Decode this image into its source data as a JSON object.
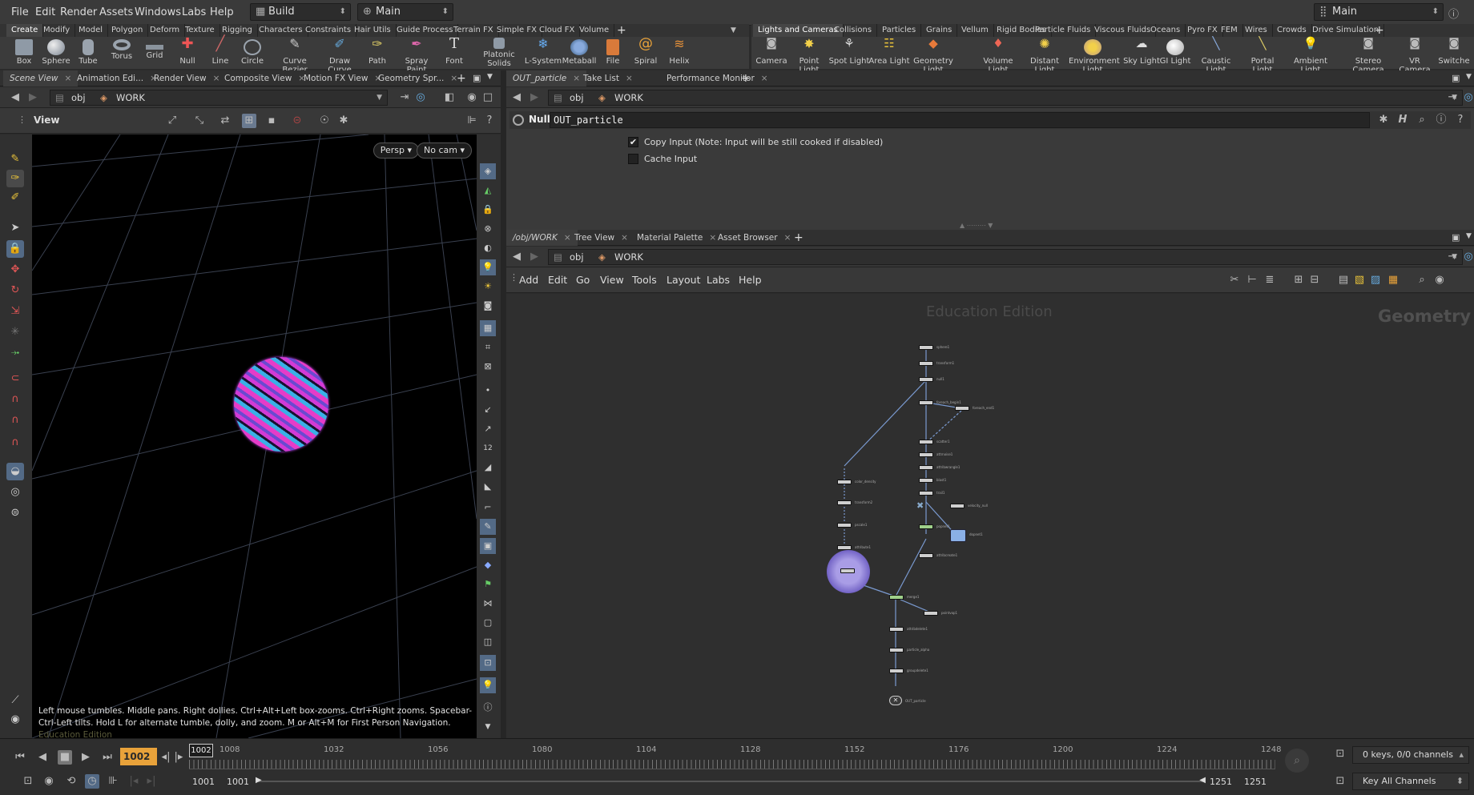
{
  "menubar": {
    "items": [
      "File",
      "Edit",
      "Render",
      "Assets",
      "Windows",
      "Labs",
      "Help"
    ],
    "desktop": "Build",
    "network": "Main",
    "right_desktop": "Main"
  },
  "shelf_left": {
    "tabs": [
      "Create",
      "Modify",
      "Model",
      "Polygon",
      "Deform",
      "Texture",
      "Rigging",
      "Characters",
      "Constraints",
      "Hair Utils",
      "Guide Process",
      "Terrain FX",
      "Simple FX",
      "Cloud FX",
      "Volume"
    ],
    "tools": [
      "Box",
      "Sphere",
      "Tube",
      "Torus",
      "Grid",
      "Null",
      "Line",
      "Circle",
      "Curve Bezier",
      "Draw Curve",
      "Path",
      "Spray Paint",
      "Font",
      "Platonic Solids",
      "L-System",
      "Metaball",
      "File",
      "Spiral",
      "Helix"
    ]
  },
  "shelf_right": {
    "tabs": [
      "Lights and Cameras",
      "Collisions",
      "Particles",
      "Grains",
      "Vellum",
      "Rigid Bodies",
      "Particle Fluids",
      "Viscous Fluids",
      "Oceans",
      "Pyro FX",
      "FEM",
      "Wires",
      "Crowds",
      "Drive Simulation"
    ],
    "tools": [
      "Camera",
      "Point Light",
      "Spot Light",
      "Area Light",
      "Geometry Light",
      "Volume Light",
      "Distant Light",
      "Environment Light",
      "Sky Light",
      "GI Light",
      "Caustic Light",
      "Portal Light",
      "Ambient Light",
      "Stereo Camera",
      "VR Camera",
      "Switche"
    ]
  },
  "left_pane": {
    "tabs": [
      "Scene View",
      "Animation Edi...",
      "Render View",
      "Composite View",
      "Motion FX View",
      "Geometry Spr..."
    ],
    "path_root": "obj",
    "path_node": "WORK",
    "view_label": "View",
    "persp": "Persp",
    "cam": "No cam",
    "hint": "Left mouse tumbles. Middle pans. Right dollies. Ctrl+Alt+Left box-zooms. Ctrl+Right zooms. Spacebar-Ctrl-Left tilts. Hold L for alternate tumble, dolly, and zoom.    M or Alt+M for First Person Navigation.",
    "edition": "Education Edition"
  },
  "params_pane": {
    "tabs": [
      "OUT_particle",
      "Take List",
      "Performance Monitor"
    ],
    "path_root": "obj",
    "path_node": "WORK",
    "node_type": "Null",
    "node_name": "OUT_particle",
    "copy_input": "Copy Input (Note: Input will be still cooked if disabled)",
    "cache_input": "Cache Input"
  },
  "network_pane": {
    "tabs": [
      "/obj/WORK",
      "Tree View",
      "Material Palette",
      "Asset Browser"
    ],
    "path_root": "obj",
    "path_node": "WORK",
    "menu": [
      "Add",
      "Edit",
      "Go",
      "View",
      "Tools",
      "Layout",
      "Labs",
      "Help"
    ],
    "watermark": "Education Edition",
    "context": "Geometry"
  },
  "timeline": {
    "current_frame": "1002",
    "marker": "1002",
    "ticks": [
      "1008",
      "1032",
      "1056",
      "1080",
      "1104",
      "1128",
      "1152",
      "1176",
      "1200",
      "1224",
      "1248"
    ],
    "start": "1001",
    "start2": "1001",
    "end": "1251",
    "end2": "1251",
    "keys": "0 keys, 0/0 channels",
    "key_all": "Key All Channels"
  },
  "colors": {
    "accent": "#e8a23a",
    "particles_a": "#e63cc8",
    "particles_b": "#3ab0e6",
    "selected_node": "#8b6fd6"
  }
}
